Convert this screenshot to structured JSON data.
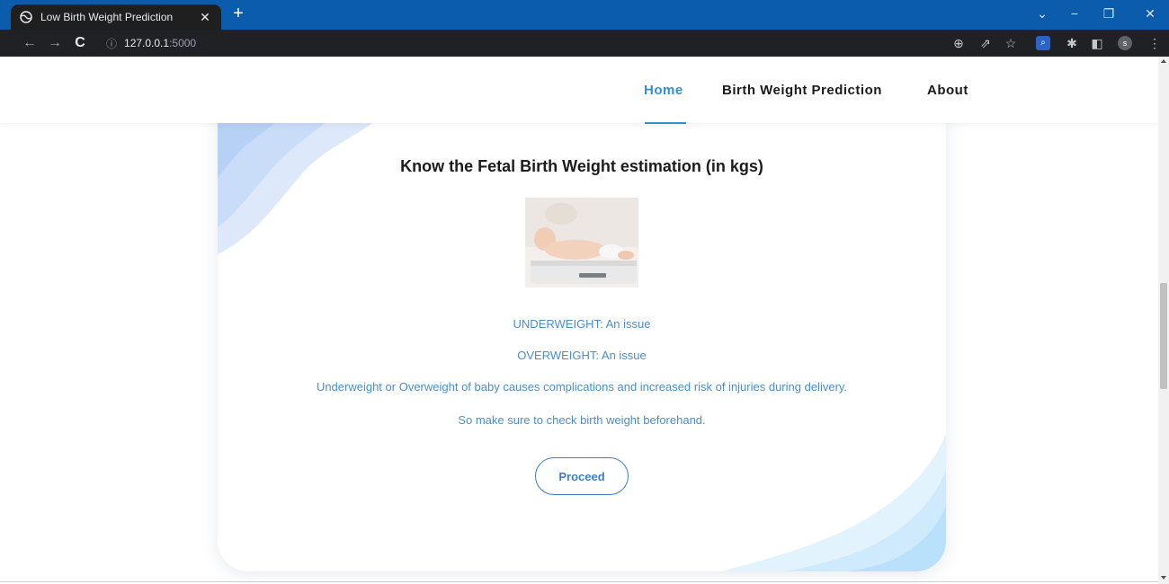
{
  "browser": {
    "tab_title": "Low Birth Weight Prediction",
    "tab_close": "✕",
    "new_tab": "+",
    "url_host": "127.0.0.1",
    "url_port": ":5000",
    "profile_initial": "s"
  },
  "nav": {
    "links": [
      "Home",
      "Birth Weight Prediction",
      "About"
    ],
    "active": "Home"
  },
  "card": {
    "title": "Know the Fetal Birth Weight estimation (in kgs)",
    "line1": "UNDERWEIGHT: An issue",
    "line2": "OVERWEIGHT: An issue",
    "line3": "Underweight or Overweight of baby causes complications and increased risk of injuries during delivery.",
    "line4": "So make sure to check birth weight beforehand.",
    "button": "Proceed"
  },
  "colors": {
    "tabstrip": "#0b5cad",
    "accent": "#2f8fd2",
    "text_blue": "#4a8fcb"
  }
}
